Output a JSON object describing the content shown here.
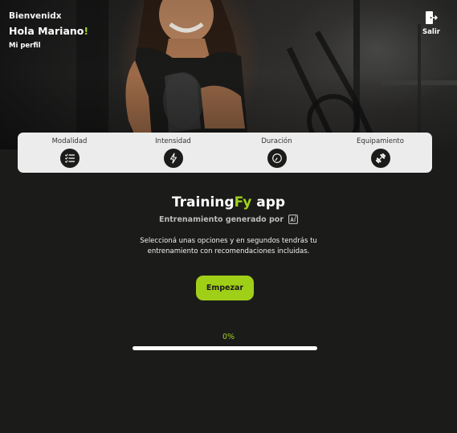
{
  "header": {
    "greeting_small": "Bienvenidx",
    "greeting_name": "Hola Mariano",
    "greeting_punct": "!",
    "profile_link": "Mi perfil",
    "logout_label": "Salir",
    "logout_icon": "logout-door-icon"
  },
  "filters": [
    {
      "label": "Modalidad",
      "icon": "checklist-icon"
    },
    {
      "label": "Intensidad",
      "icon": "lightning-icon"
    },
    {
      "label": "Duración",
      "icon": "clock-icon"
    },
    {
      "label": "Equipamiento",
      "icon": "dumbbell-icon"
    }
  ],
  "main": {
    "title_part1": "Training",
    "title_accent": "Fy",
    "title_part2": " app",
    "subtitle": "Entrenamiento generado por",
    "subtitle_icon": "ai-icon",
    "description": "Seleccioná unas opciones y en segundos tendrás tu entrenamiento con recomendaciones incluidas.",
    "start_button": "Empezar",
    "progress_label": "0%",
    "progress_value": 0
  },
  "colors": {
    "accent": "#a0cf17",
    "background": "#1b1b1a",
    "card": "#ececec"
  }
}
